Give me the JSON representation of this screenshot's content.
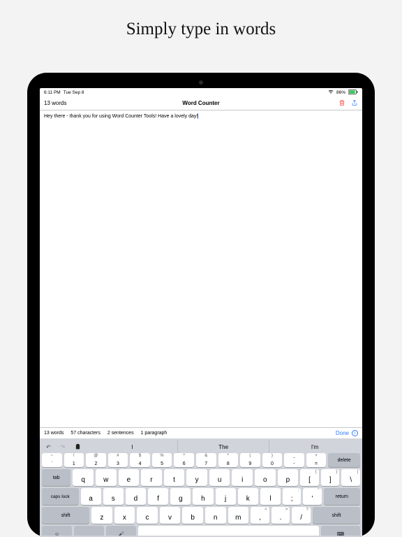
{
  "promo": {
    "title": "Simply type in words"
  },
  "status": {
    "time": "6:11 PM",
    "date": "Tue Sep 8",
    "battery": "86%"
  },
  "nav": {
    "word_count": "13 words",
    "title": "Word Counter"
  },
  "editor": {
    "text": "Hey there - thank you for using Word Counter Tools! Have a lovely day!"
  },
  "stats": {
    "words": "13 words",
    "chars": "57 characters",
    "sentences": "2 sentences",
    "paragraphs": "1 paragraph",
    "done": "Done"
  },
  "keyboard": {
    "suggestions": [
      "I",
      "The",
      "I'm"
    ],
    "num_row": [
      {
        "t": "~",
        "b": "`"
      },
      {
        "t": "!",
        "b": "1"
      },
      {
        "t": "@",
        "b": "2"
      },
      {
        "t": "#",
        "b": "3"
      },
      {
        "t": "$",
        "b": "4"
      },
      {
        "t": "%",
        "b": "5"
      },
      {
        "t": "^",
        "b": "6"
      },
      {
        "t": "&",
        "b": "7"
      },
      {
        "t": "*",
        "b": "8"
      },
      {
        "t": "(",
        "b": "9"
      },
      {
        "t": ")",
        "b": "0"
      },
      {
        "t": "_",
        "b": "-"
      },
      {
        "t": "+",
        "b": "="
      }
    ],
    "delete": "delete",
    "tab": "tab",
    "row1": [
      "q",
      "w",
      "e",
      "r",
      "t",
      "y",
      "u",
      "i",
      "o",
      "p"
    ],
    "row1_extra": [
      {
        "t": "{",
        "b": "["
      },
      {
        "t": "}",
        "b": "]"
      },
      {
        "t": "|",
        "b": "\\"
      }
    ],
    "caps": "caps lock",
    "row2": [
      "a",
      "s",
      "d",
      "f",
      "g",
      "h",
      "j",
      "k",
      "l"
    ],
    "row2_extra": [
      {
        "t": ":",
        "b": ";"
      },
      {
        "t": "\"",
        "b": "'"
      }
    ],
    "return": "return",
    "shift": "shift",
    "row3": [
      "z",
      "x",
      "c",
      "v",
      "b",
      "n",
      "m"
    ],
    "row3_extra": [
      {
        "t": "<",
        "b": ","
      },
      {
        "t": ">",
        "b": "."
      },
      {
        "t": "?",
        "b": "/"
      }
    ]
  }
}
